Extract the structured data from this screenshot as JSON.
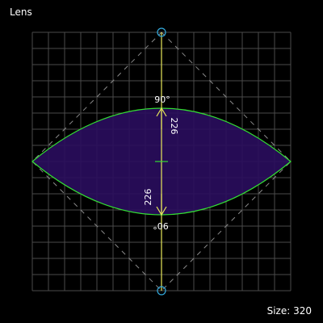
{
  "title": "Lens",
  "size_label": "Size:",
  "size_value": "320",
  "angle_top": "90°",
  "angle_bottom": "90°",
  "sag_top": "226",
  "sag_bottom": "226",
  "colors": {
    "background": "#000000",
    "grid": "#4a4a4a",
    "lens_fill": "#2a0d5e",
    "lens_stroke": "#33dd33",
    "axis": "#e8e85a",
    "handle": "#33aadd",
    "diamond": "#8a8a8a",
    "label": "#ffffff"
  }
}
